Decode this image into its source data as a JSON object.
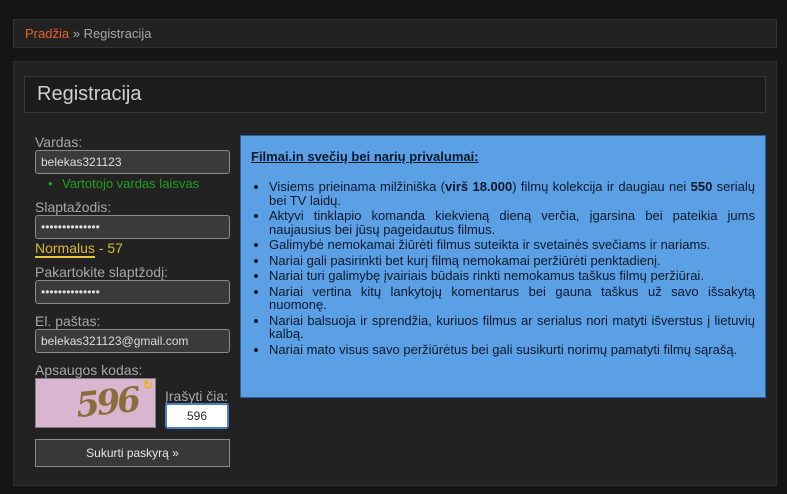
{
  "breadcrumb": {
    "home": "Pradžia",
    "separator": "»",
    "current": "Registracija"
  },
  "page_title": "Registracija",
  "form": {
    "username": {
      "label": "Vardas:",
      "value": "belekas321123"
    },
    "username_status": "Vartotojo vardas laisvas",
    "password": {
      "label": "Slaptažodis:",
      "value": "••••••••••••••"
    },
    "strength": {
      "word": "Normalus",
      "separator": "-",
      "score": "57"
    },
    "password_repeat": {
      "label": "Pakartokite slaptžodį:",
      "value": "••••••••••••••"
    },
    "email": {
      "label": "El. paštas:",
      "value": "belekas321123@gmail.com"
    },
    "captcha": {
      "label": "Apsaugos kodas:",
      "image_text": "596",
      "input_label": "Įrašyti čia:",
      "input_value": "596"
    },
    "submit_label": "Sukurti paskyrą »"
  },
  "info": {
    "heading": "Filmai.in svečių bei narių privalumai:",
    "items": [
      "Visiems prieinama milžiniška (<b>virš 18.000</b>) filmų kolekcija ir daugiau nei <b>550</b> serialų bei TV laidų.",
      "Aktyvi tinklapio komanda kiekvieną dieną verčia, įgarsina bei pateikia jums naujausius bei jūsų pageidautus filmus.",
      "Galimybė nemokamai žiūrėti filmus suteikta ir svetainės svečiams ir nariams.",
      "Nariai gali pasirinkti bet kurį filmą nemokamai peržiūrėti penktadienį.",
      "Nariai turi galimybę įvairiais būdais rinkti nemokamus taškus filmų peržiūrai.",
      "Nariai vertina kitų lankytojų komentarus bei gauna taškus už savo išsakytą nuomonę.",
      "Nariai balsuoja ir sprendžia, kuriuos filmus ar serialus nori matyti išverstus į lietuvių kalbą.",
      "Nariai mato visus savo peržiūrėtus bei gali susikurti norimų pamatyti filmų sąrašą."
    ]
  },
  "colors": {
    "link": "#e8622c",
    "success": "#1fa01f",
    "strength": "#d9b935",
    "info_bg": "#5b9fe4"
  },
  "icons": {
    "captcha_refresh": "refresh-icon"
  }
}
